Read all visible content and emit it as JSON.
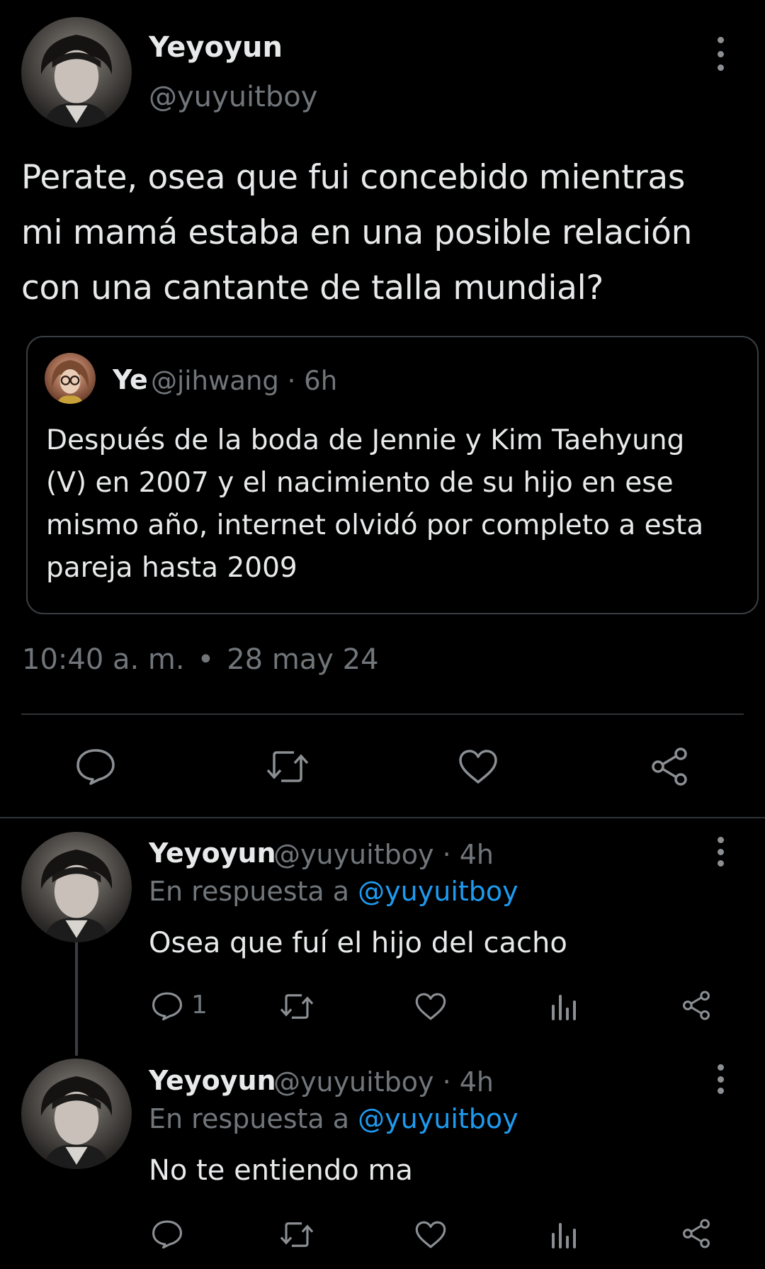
{
  "main_tweet": {
    "author_name": "Yeyoyun",
    "author_handle": "@yuyuitboy",
    "text_lines": [
      "Perate, osea que fui concebido mientras",
      "mi mamá estaba en una posible relación",
      "con una cantante de talla mundial?"
    ],
    "time": "10:40 a. m.",
    "separator": "•",
    "date": "28 may 24",
    "icons": [
      "reply-icon",
      "retweet-icon",
      "like-icon",
      "share-icon",
      "more-icon"
    ]
  },
  "quoted_tweet": {
    "author_name": "Ye",
    "author_handle": "@jihwang",
    "age": "· 6h",
    "text_lines": [
      "Después de la boda de Jennie y Kim Taehyung",
      "(V) en 2007 y el nacimiento de su hijo en ese",
      "mismo año, internet olvidó por completo a esta",
      "pareja hasta 2009"
    ]
  },
  "replies": [
    {
      "author_name": "Yeyoyun",
      "author_handle": "@yuyuitboy",
      "age": "· 4h",
      "reply_prefix": "En respuesta a",
      "reply_mention": "@yuyuitboy",
      "text": "Osea que fuí el hijo del cacho",
      "reply_count": "1"
    },
    {
      "author_name": "Yeyoyun",
      "author_handle": "@yuyuitboy",
      "age": "· 4h",
      "reply_prefix": "En respuesta a",
      "reply_mention": "@yuyuitboy",
      "text": "No te entiendo ma",
      "reply_count": ""
    }
  ],
  "colors": {
    "background": "#000000",
    "text": "#e7e9ea",
    "muted": "#71767b",
    "link": "#1d9bf0",
    "border": "#2f3336"
  }
}
